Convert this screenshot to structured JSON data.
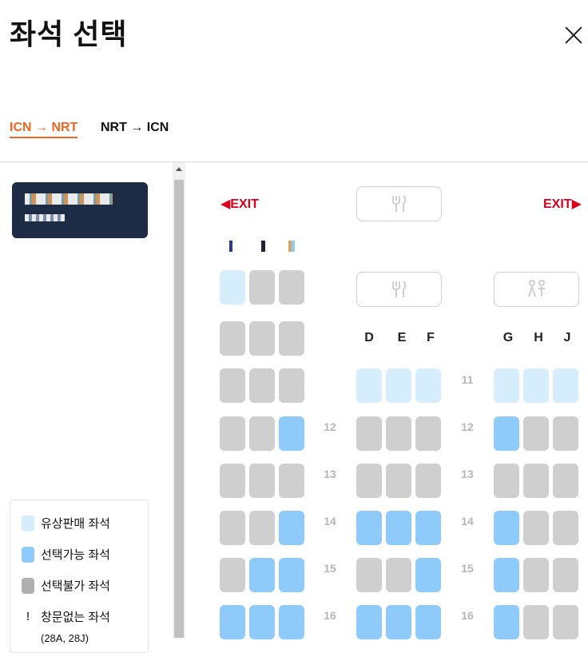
{
  "header": {
    "title": "좌석 선택"
  },
  "tabs": [
    {
      "label": "ICN → NRT",
      "active": true
    },
    {
      "label": "NRT → ICN",
      "active": false
    }
  ],
  "legend": [
    {
      "label": "유상판매 좌석",
      "swatch": "paid"
    },
    {
      "label": "선택가능 좌석",
      "swatch": "available"
    },
    {
      "label": "선택불가 좌석",
      "swatch": "unavailable"
    },
    {
      "label": "창문없는 좌석",
      "swatch": "no-window",
      "mark": "!"
    },
    {
      "label": "(28A, 28J)"
    }
  ],
  "cabin": {
    "exit_left": "◀EXIT",
    "exit_right": "EXIT▶",
    "columns_middle": [
      "D",
      "E",
      "F"
    ],
    "columns_right": [
      "G",
      "H",
      "J"
    ],
    "row_labels": [
      "12",
      "13",
      "14",
      "15",
      "16"
    ],
    "row_11_label": "11",
    "colors": {
      "paid": "#d6eefb",
      "available": "#8ecbfb",
      "unavailable": "#cfcfcf",
      "accent": "#f26522",
      "exit": "#d8001c"
    }
  }
}
